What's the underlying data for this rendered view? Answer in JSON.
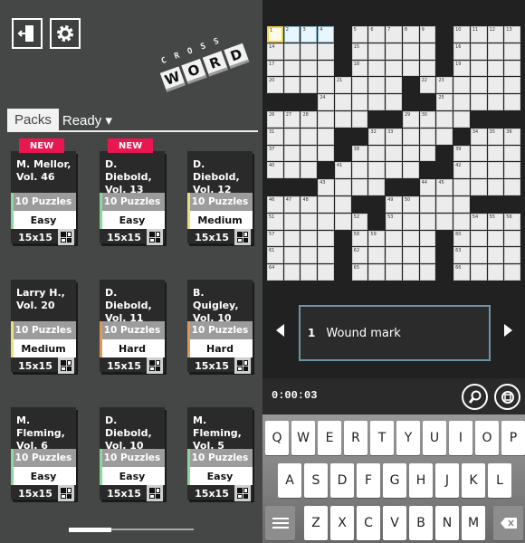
{
  "left": {
    "exit_icon": "exit-door-icon",
    "settings_icon": "gear-icon",
    "logo": {
      "top": "CROSS",
      "tiles": [
        "W",
        "O",
        "R",
        "D"
      ]
    },
    "tabs": {
      "packs": "Packs",
      "ready": "Ready ▾"
    },
    "packs": [
      {
        "badge": "NEW",
        "title1": "M. Mellor,",
        "title2": "Vol. 46",
        "puzzles": "10 Puzzles",
        "difficulty": "Easy",
        "size": "15x15",
        "color": "#8fd49a"
      },
      {
        "badge": "NEW",
        "title1": "D. Diebold,",
        "title2": "Vol. 13",
        "puzzles": "10 Puzzles",
        "difficulty": "Easy",
        "size": "15x15",
        "color": "#8fd49a"
      },
      {
        "badge": "",
        "title1": "D. Diebold,",
        "title2": "Vol. 12",
        "puzzles": "10 Puzzles",
        "difficulty": "Medium",
        "size": "15x15",
        "color": "#e8e07a"
      },
      {
        "badge": "",
        "title1": "Larry H.,",
        "title2": "Vol. 20",
        "puzzles": "10 Puzzles",
        "difficulty": "Medium",
        "size": "15x15",
        "color": "#e8e07a"
      },
      {
        "badge": "",
        "title1": "D. Diebold,",
        "title2": "Vol. 11",
        "puzzles": "10 Puzzles",
        "difficulty": "Hard",
        "size": "15x15",
        "color": "#d99a5a"
      },
      {
        "badge": "",
        "title1": "B. Quigley,",
        "title2": "Vol. 10",
        "puzzles": "10 Puzzles",
        "difficulty": "Hard",
        "size": "15x15",
        "color": "#d99a5a"
      },
      {
        "badge": "",
        "title1": "M. Fleming,",
        "title2": "Vol. 6",
        "puzzles": "10 Puzzles",
        "difficulty": "Easy",
        "size": "15x15",
        "color": "#8fd49a"
      },
      {
        "badge": "",
        "title1": "D. Diebold,",
        "title2": "Vol. 10",
        "puzzles": "10 Puzzles",
        "difficulty": "Easy",
        "size": "15x15",
        "color": "#8fd49a"
      },
      {
        "badge": "",
        "title1": "M. Fleming,",
        "title2": "Vol. 5",
        "puzzles": "10 Puzzles",
        "difficulty": "Easy",
        "size": "15x15",
        "color": "#8fd49a"
      }
    ],
    "scroll_position": 0.2
  },
  "puzzle": {
    "rows": [
      "....#.....#....",
      "....#.....#....",
      "....#.....#....",
      "........#......",
      "###.....##.....",
      "......##....###",
      "....##.....#...",
      "....#.....#....",
      "...#.....##....",
      "#?#....##......",
      ".....##.....###",
      "......#........",
      "....#.....#....",
      "....#.....#....",
      "....#.....#...."
    ],
    "selected_cell": [
      0,
      0
    ],
    "highlighted_word": [
      [
        0,
        0
      ],
      [
        0,
        1
      ],
      [
        0,
        2
      ],
      [
        0,
        3
      ]
    ]
  },
  "clue": {
    "number": "1",
    "text": "Wound mark",
    "prev_icon": "arrow-left-icon",
    "next_icon": "arrow-right-icon"
  },
  "toolbar": {
    "timer": "0:00:03",
    "zoom_icon": "magnifier-icon",
    "help_icon": "lifebuoy-icon"
  },
  "keyboard": {
    "row1": [
      "Q",
      "W",
      "E",
      "R",
      "T",
      "Y",
      "U",
      "I",
      "O",
      "P"
    ],
    "row2": [
      "A",
      "S",
      "D",
      "F",
      "G",
      "H",
      "J",
      "K",
      "L"
    ],
    "row3": [
      "Z",
      "X",
      "C",
      "V",
      "B",
      "N",
      "M"
    ],
    "menu_icon": "menu-icon",
    "backspace_icon": "backspace-icon"
  }
}
